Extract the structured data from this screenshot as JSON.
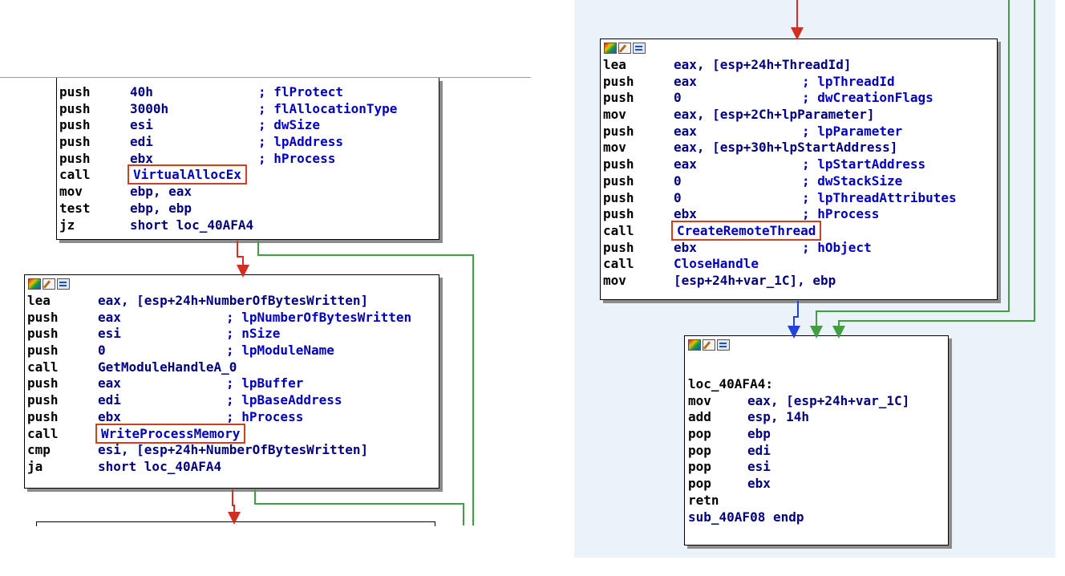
{
  "colors": {
    "panel_bg": "#eaf4f8",
    "true_edge": "#d03020",
    "false_edge": "#40a040",
    "normal_edge": "#2040e0",
    "highlight": "#d04020"
  },
  "left": {
    "block1": {
      "partial_top": "call    VirtualAllocEx",
      "lines": [
        {
          "m": "push",
          "o": "40h",
          "c": "; flProtect"
        },
        {
          "m": "push",
          "o": "3000h",
          "c": "; flAllocationType"
        },
        {
          "m": "push",
          "o": "esi",
          "c": "; dwSize"
        },
        {
          "m": "push",
          "o": "edi",
          "c": "; lpAddress"
        },
        {
          "m": "push",
          "o": "ebx",
          "c": "; hProcess"
        },
        {
          "m": "call",
          "o": "VirtualAllocEx",
          "c": ""
        },
        {
          "m": "mov",
          "o": "ebp, eax",
          "c": ""
        },
        {
          "m": "test",
          "o": "ebp, ebp",
          "c": ""
        },
        {
          "m": "jz",
          "o": "short loc_40AFA4",
          "c": ""
        }
      ]
    },
    "block2": {
      "lines": [
        {
          "m": "lea",
          "o": "eax, [esp+24h+NumberOfBytesWritten]",
          "c": ""
        },
        {
          "m": "push",
          "o": "eax",
          "c": "; lpNumberOfBytesWritten"
        },
        {
          "m": "push",
          "o": "esi",
          "c": "; nSize"
        },
        {
          "m": "push",
          "o": "0",
          "c": "; lpModuleName"
        },
        {
          "m": "call",
          "o": "GetModuleHandleA_0",
          "c": ""
        },
        {
          "m": "push",
          "o": "eax",
          "c": "; lpBuffer"
        },
        {
          "m": "push",
          "o": "edi",
          "c": "; lpBaseAddress"
        },
        {
          "m": "push",
          "o": "ebx",
          "c": "; hProcess"
        },
        {
          "m": "call",
          "o": "WriteProcessMemory",
          "c": ""
        },
        {
          "m": "cmp",
          "o": "esi, [esp+24h+NumberOfBytesWritten]",
          "c": ""
        },
        {
          "m": "ja",
          "o": "short loc_40AFA4",
          "c": ""
        }
      ]
    }
  },
  "right": {
    "block1": {
      "lines": [
        {
          "m": "lea",
          "o": "eax, [esp+24h+ThreadId]",
          "c": ""
        },
        {
          "m": "push",
          "o": "eax",
          "c": "; lpThreadId"
        },
        {
          "m": "push",
          "o": "0",
          "c": "; dwCreationFlags"
        },
        {
          "m": "mov",
          "o": "eax, [esp+2Ch+lpParameter]",
          "c": ""
        },
        {
          "m": "push",
          "o": "eax",
          "c": "; lpParameter"
        },
        {
          "m": "mov",
          "o": "eax, [esp+30h+lpStartAddress]",
          "c": ""
        },
        {
          "m": "push",
          "o": "eax",
          "c": "; lpStartAddress"
        },
        {
          "m": "push",
          "o": "0",
          "c": "; dwStackSize"
        },
        {
          "m": "push",
          "o": "0",
          "c": "; lpThreadAttributes"
        },
        {
          "m": "push",
          "o": "ebx",
          "c": "; hProcess"
        },
        {
          "m": "call",
          "o": "CreateRemoteThread",
          "c": ""
        },
        {
          "m": "push",
          "o": "ebx",
          "c": "; hObject"
        },
        {
          "m": "call",
          "o": "CloseHandle",
          "c": ""
        },
        {
          "m": "mov",
          "o": "[esp+24h+var_1C], ebp",
          "c": ""
        }
      ]
    },
    "block2": {
      "label": "loc_40AFA4:",
      "lines": [
        {
          "m": "mov",
          "o": "eax, [esp+24h+var_1C]",
          "c": ""
        },
        {
          "m": "add",
          "o": "esp, 14h",
          "c": ""
        },
        {
          "m": "pop",
          "o": "ebp",
          "c": ""
        },
        {
          "m": "pop",
          "o": "edi",
          "c": ""
        },
        {
          "m": "pop",
          "o": "esi",
          "c": ""
        },
        {
          "m": "pop",
          "o": "ebx",
          "c": ""
        },
        {
          "m": "retn",
          "o": "",
          "c": ""
        }
      ],
      "end": "sub_40AF08 endp"
    }
  }
}
